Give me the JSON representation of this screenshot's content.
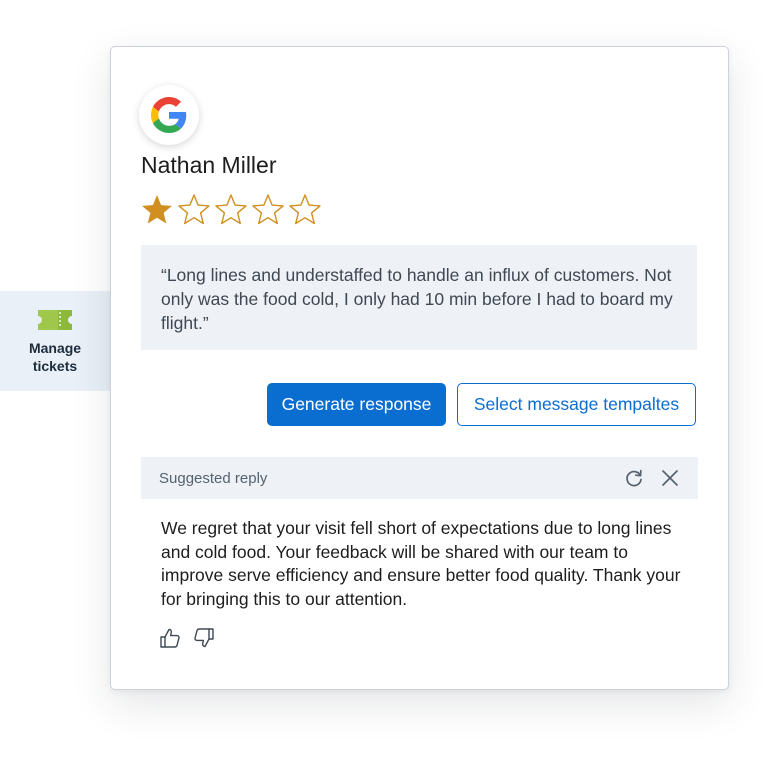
{
  "sidebar": {
    "item": {
      "icon": "ticket-icon",
      "label": "Manage tickets",
      "color": "#8cb83c"
    }
  },
  "review": {
    "source_icon": "google-logo",
    "reviewer_name": "Nathan Miller",
    "rating": 1,
    "max_rating": 5,
    "star_color": "#d08f1f",
    "text": "“Long lines and understaffed to handle an influx of customers. Not only was the food cold, I only had 10 min before I had to board my flight.”"
  },
  "actions": {
    "generate_label": "Generate response",
    "templates_label": "Select message tempaltes"
  },
  "suggested_reply": {
    "title": "Suggested reply",
    "refresh_icon": "refresh-icon",
    "close_icon": "close-icon",
    "text": "We regret that your visit fell short of expectations due to long lines and cold food. Your feedback will be shared with our team to improve serve efficiency and ensure better food quality. Thank your for bringing this to our attention.",
    "like_icon": "thumbs-up-icon",
    "dislike_icon": "thumbs-down-icon"
  },
  "colors": {
    "accent": "#0a6ed1",
    "panel_bg": "#eef1f5"
  }
}
